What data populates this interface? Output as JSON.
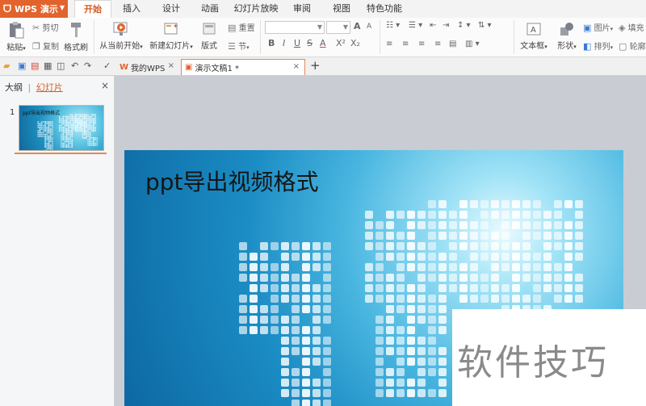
{
  "app": {
    "name": "WPS 演示"
  },
  "menu": {
    "tabs": [
      "开始",
      "插入",
      "设计",
      "动画",
      "幻灯片放映",
      "审阅",
      "视图",
      "特色功能"
    ],
    "active": "开始"
  },
  "ribbon": {
    "paste": "粘贴",
    "cut": "剪切",
    "copy": "复制",
    "format_painter": "格式刷",
    "from_current": "从当前开始",
    "new_slide": "新建幻灯片",
    "layout": "版式",
    "reset": "重置",
    "section": "节",
    "bold": "B",
    "italic": "I",
    "underline": "U",
    "strike": "S",
    "font_color": "A",
    "superscript": "X²",
    "subscript": "X₂",
    "grow": "A",
    "shrink": "A",
    "textbox": "文本框",
    "shape": "形状",
    "picture": "图片",
    "arrange": "排列",
    "fill": "填充",
    "outline": "轮廓"
  },
  "tabs": {
    "my_wps": "我的WPS",
    "document": "演示文稿1 *",
    "add": "+"
  },
  "side_panel": {
    "outline_tab": "大纲",
    "divider": "|",
    "slides_tab": "幻灯片",
    "close": "×",
    "slide_number": "1",
    "thumb_title": "ppt导出视频格式"
  },
  "slide": {
    "title": "ppt导出视频格式"
  },
  "watermark": {
    "text": "软件技巧"
  },
  "colors": {
    "accent": "#e2632c",
    "slide_background": "#1b8cc4"
  }
}
